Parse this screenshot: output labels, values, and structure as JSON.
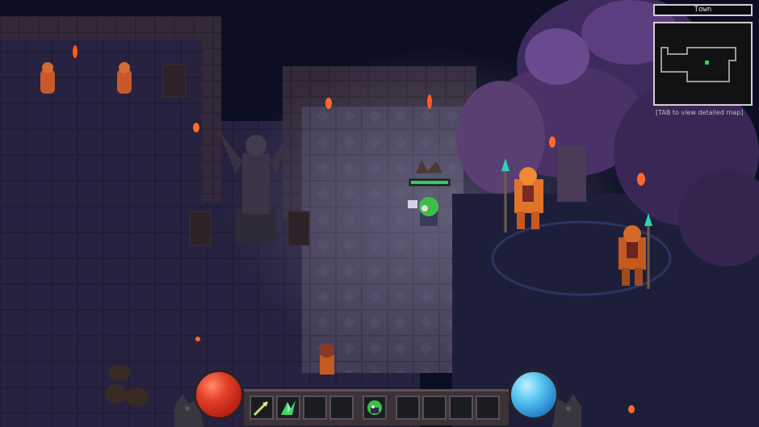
{
  "hud": {
    "location_name": "Town",
    "map_hint": "[TAB to view detailed map]"
  },
  "hotbar": {
    "slots": [
      {
        "icon": "spear-arrow-icon",
        "filled": true
      },
      {
        "icon": "green-crystal-icon",
        "filled": true
      },
      {
        "icon": "empty-slot",
        "filled": false
      },
      {
        "icon": "empty-slot",
        "filled": false
      },
      {
        "icon": "character-portrait-icon",
        "filled": true
      },
      {
        "icon": "empty-slot",
        "filled": false
      },
      {
        "icon": "empty-slot",
        "filled": false
      },
      {
        "icon": "empty-slot",
        "filled": false
      },
      {
        "icon": "empty-slot",
        "filled": false
      }
    ]
  },
  "orbs": {
    "health": {
      "color": "#e3402a",
      "level": 1.0
    },
    "mana": {
      "color": "#58c6f2",
      "level": 1.0
    }
  },
  "colors": {
    "floor_dark": "#1e1b33",
    "floor_lit": "#4a4458",
    "wall": "#2f2830",
    "foliage": "#5a3a7a",
    "torch": "#ff6a2a",
    "guard_armor": "#e0742a",
    "player_hair": "#3bbf4a",
    "minimap_player": "#2ad84a"
  }
}
